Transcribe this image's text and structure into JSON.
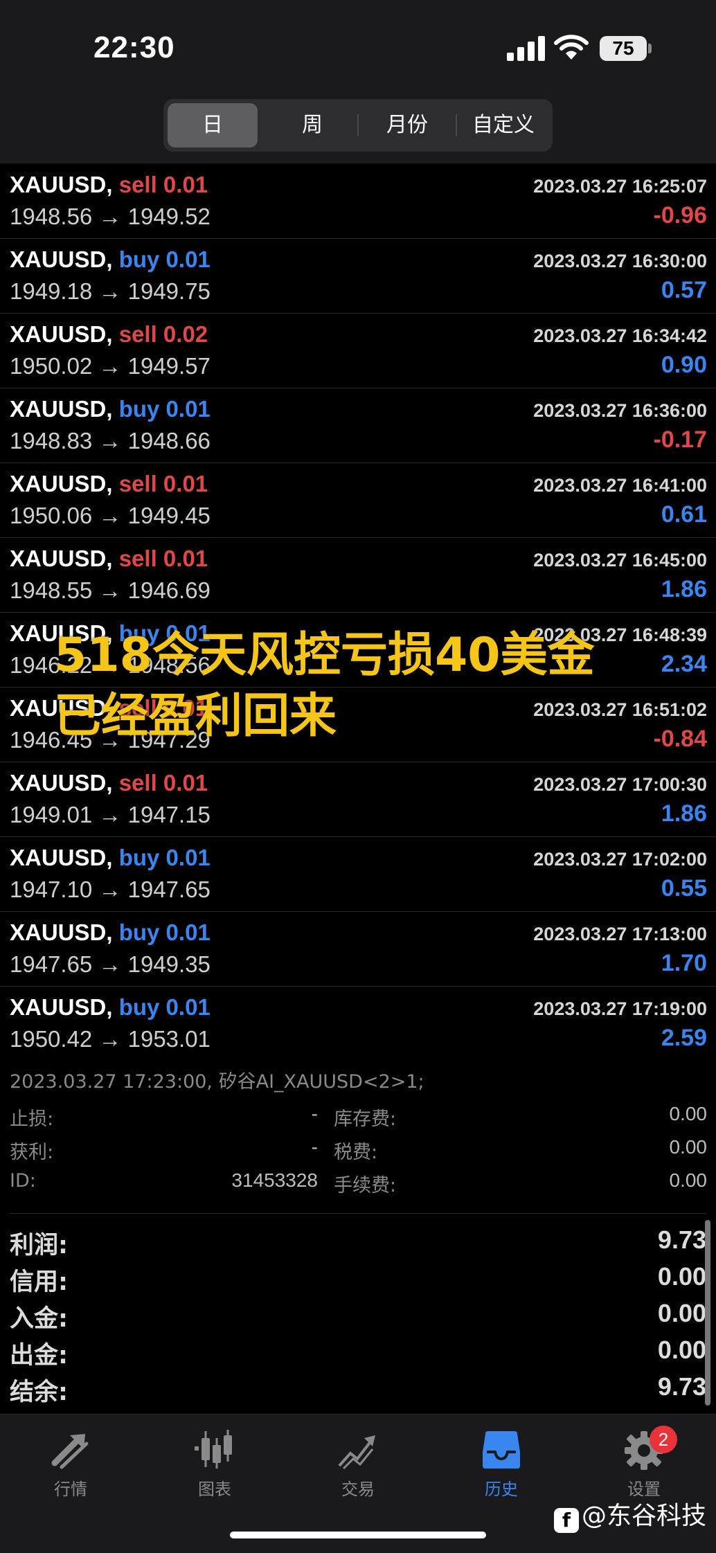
{
  "status_bar": {
    "time": "22:30",
    "battery": "75"
  },
  "period_tabs": [
    {
      "label": "日",
      "active": true
    },
    {
      "label": "周",
      "active": false
    },
    {
      "label": "月份",
      "active": false
    },
    {
      "label": "自定义",
      "active": false
    }
  ],
  "trades": [
    {
      "symbol": "XAUUSD,",
      "side": "sell",
      "volume": "0.01",
      "time": "2023.03.27 16:25:07",
      "prices": "1948.56 → 1949.52",
      "profit": "-0.96"
    },
    {
      "symbol": "XAUUSD,",
      "side": "buy",
      "volume": "0.01",
      "time": "2023.03.27 16:30:00",
      "prices": "1949.18 → 1949.75",
      "profit": "0.57"
    },
    {
      "symbol": "XAUUSD,",
      "side": "sell",
      "volume": "0.02",
      "time": "2023.03.27 16:34:42",
      "prices": "1950.02 → 1949.57",
      "profit": "0.90"
    },
    {
      "symbol": "XAUUSD,",
      "side": "buy",
      "volume": "0.01",
      "time": "2023.03.27 16:36:00",
      "prices": "1948.83 → 1948.66",
      "profit": "-0.17"
    },
    {
      "symbol": "XAUUSD,",
      "side": "sell",
      "volume": "0.01",
      "time": "2023.03.27 16:41:00",
      "prices": "1950.06 → 1949.45",
      "profit": "0.61"
    },
    {
      "symbol": "XAUUSD,",
      "side": "sell",
      "volume": "0.01",
      "time": "2023.03.27 16:45:00",
      "prices": "1948.55 → 1946.69",
      "profit": "1.86"
    },
    {
      "symbol": "XAUUSD,",
      "side": "buy",
      "volume": "0.01",
      "time": "2023.03.27 16:48:39",
      "prices": "1946.22 → 1948.56",
      "profit": "2.34"
    },
    {
      "symbol": "XAUUSD,",
      "side": "sell",
      "volume": "0.01",
      "time": "2023.03.27 16:51:02",
      "prices": "1946.45 → 1947.29",
      "profit": "-0.84"
    },
    {
      "symbol": "XAUUSD,",
      "side": "sell",
      "volume": "0.01",
      "time": "2023.03.27 17:00:30",
      "prices": "1949.01 → 1947.15",
      "profit": "1.86"
    },
    {
      "symbol": "XAUUSD,",
      "side": "buy",
      "volume": "0.01",
      "time": "2023.03.27 17:02:00",
      "prices": "1947.10 → 1947.65",
      "profit": "0.55"
    },
    {
      "symbol": "XAUUSD,",
      "side": "buy",
      "volume": "0.01",
      "time": "2023.03.27 17:13:00",
      "prices": "1947.65 → 1949.35",
      "profit": "1.70"
    },
    {
      "symbol": "XAUUSD,",
      "side": "buy",
      "volume": "0.01",
      "time": "2023.03.27 17:19:00",
      "prices": "1950.42 → 1953.01",
      "profit": "2.59"
    }
  ],
  "overlay": {
    "line1": "518今天风控亏损40美金",
    "line2": "已经盈利回来"
  },
  "selected_detail": {
    "comment": "2023.03.27 17:23:00, 矽谷AI_XAUUSD<2>1;",
    "stop_loss_label": "止损:",
    "stop_loss": "-",
    "take_profit_label": "获利:",
    "take_profit": "-",
    "id_label": "ID:",
    "id": "31453328",
    "swap_label": "库存费:",
    "swap": "0.00",
    "tax_label": "税费:",
    "tax": "0.00",
    "commission_label": "手续费:",
    "commission": "0.00"
  },
  "summary": [
    {
      "label": "利润:",
      "value": "9.73"
    },
    {
      "label": "信用:",
      "value": "0.00"
    },
    {
      "label": "入金:",
      "value": "0.00"
    },
    {
      "label": "出金:",
      "value": "0.00"
    },
    {
      "label": "结余:",
      "value": "9.73"
    }
  ],
  "tab_bar": [
    {
      "label": "行情",
      "icon": "quotes-arrows-icon",
      "active": false
    },
    {
      "label": "图表",
      "icon": "candlestick-chart-icon",
      "active": false
    },
    {
      "label": "交易",
      "icon": "trade-chart-icon",
      "active": false
    },
    {
      "label": "历史",
      "icon": "history-inbox-icon",
      "active": true
    },
    {
      "label": "设置",
      "icon": "gear-icon",
      "active": false,
      "badge": "2"
    }
  ],
  "colors": {
    "sell": "#e04848",
    "buy": "#3a86f0",
    "overlay": "#f5c518",
    "active_tab": "#3a86f0"
  },
  "watermark": {
    "text": "@东谷科技",
    "icon": "toutiao-logo-icon"
  }
}
